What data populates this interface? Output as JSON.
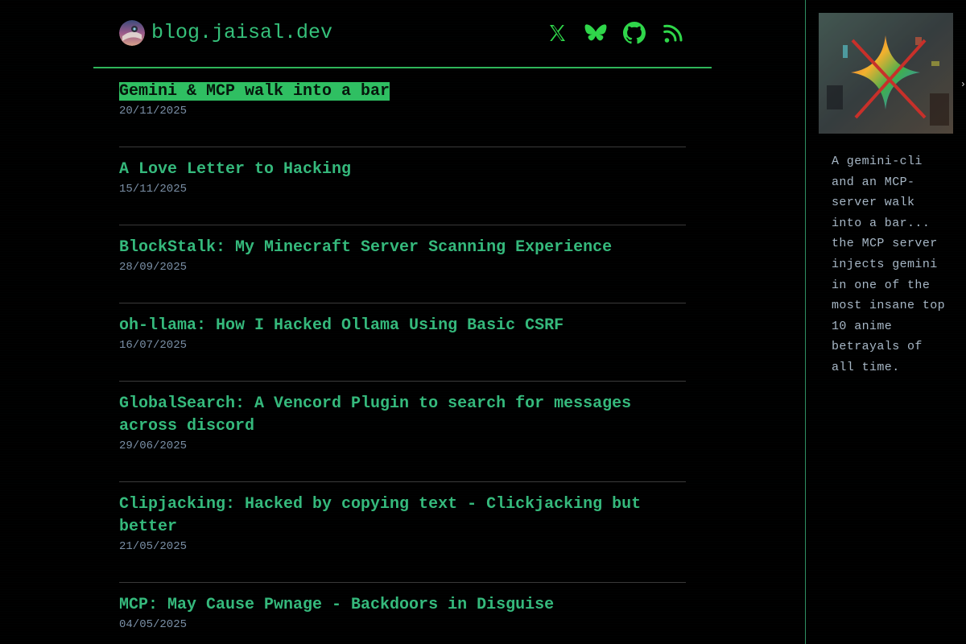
{
  "site": {
    "name": "blog.jaisal.dev"
  },
  "socials": [
    {
      "icon": "x-icon",
      "color": "#2fd64a"
    },
    {
      "icon": "bluesky-icon",
      "color": "#2fd64a"
    },
    {
      "icon": "github-icon",
      "color": "#2fd64a"
    },
    {
      "icon": "rss-icon",
      "color": "#2fd64a"
    }
  ],
  "posts": [
    {
      "title": "Gemini & MCP walk into a bar",
      "date": "20/11/2025",
      "active": true
    },
    {
      "title": "A Love Letter to Hacking",
      "date": "15/11/2025"
    },
    {
      "title": "BlockStalk: My Minecraft Server Scanning Experience",
      "date": "28/09/2025"
    },
    {
      "title": "oh-llama: How I Hacked Ollama Using Basic CSRF",
      "date": "16/07/2025"
    },
    {
      "title": "GlobalSearch: A Vencord Plugin to search for messages across discord",
      "date": "29/06/2025"
    },
    {
      "title": "Clipjacking: Hacked by copying text - Clickjacking but better",
      "date": "21/05/2025"
    },
    {
      "title": "MCP: May Cause Pwnage - Backdoors in Disguise",
      "date": "04/05/2025"
    }
  ],
  "sidebar": {
    "description": "A gemini-cli and an MCP-server walk into a bar... the MCP server injects gemini in one of the most insane top 10 anime betrayals of all time.",
    "arrow": "›"
  },
  "colors": {
    "accent": "#35c07a",
    "highlight": "#2fbf62",
    "date": "#7a8fa6",
    "divider": "#3a3a3a"
  }
}
